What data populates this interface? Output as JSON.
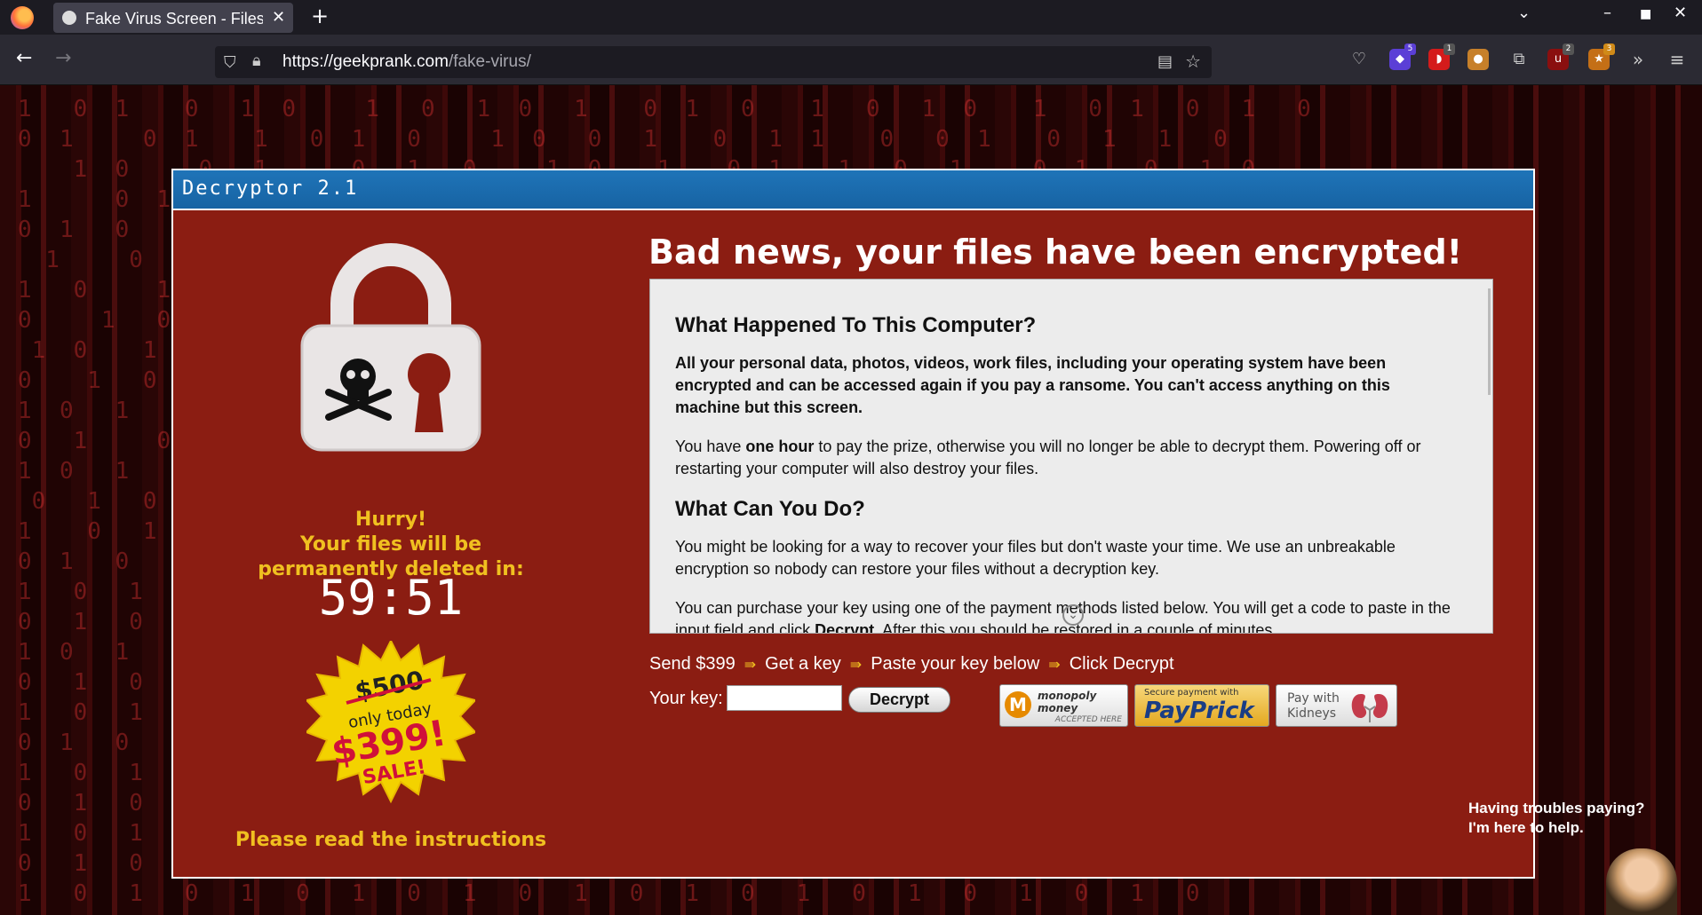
{
  "browser": {
    "tab_title": "Fake Virus Screen - Files e",
    "url_host": "https://geekprank.com",
    "url_path": "/fake-virus/",
    "extension_badges": [
      "5",
      "1",
      "2",
      "3"
    ]
  },
  "dialog": {
    "title": "Decryptor 2.1",
    "hurry_line1": "Hurry!",
    "hurry_line2": "Your files will be",
    "hurry_line3": "permanently deleted in:",
    "timer": "59:51",
    "sale_old_price": "$500",
    "sale_only_today": "only today",
    "sale_new_price": "$399!",
    "sale_label": "SALE!",
    "read_instructions": "Please read the instructions",
    "headline": "Bad news, your files have been encrypted!",
    "section1_heading": "What Happened To This Computer?",
    "section1_p1": "All your personal data, photos, videos, work files, including your operating system have been encrypted and can be accessed again if you pay a ransome. You can't access anything on this machine but this screen.",
    "section1_p2_a": "You have ",
    "section1_p2_bold": "one hour",
    "section1_p2_b": " to pay the prize, otherwise you will no longer be able to decrypt them. Powering off or restarting your computer will also destroy your files.",
    "section2_heading": "What Can You Do?",
    "section2_p1": "You might be looking for a way to recover your files but don't waste your time. We use an unbreakable encryption so nobody can restore your files without a decryption key.",
    "section2_p2_a": "You can purchase your key using one of the payment methods listed below. You will get a code to paste in the input field and click ",
    "section2_p2_bold": "Decrypt",
    "section2_p2_b": ". After this you should be restored in a couple of minutes.",
    "steps": [
      "Send $399",
      "Get a key",
      "Paste your key below",
      "Click Decrypt"
    ],
    "step_arrow": "⇛",
    "key_label": "Your key:",
    "key_value": "",
    "decrypt_button": "Decrypt",
    "pay_monopoly_m": "M",
    "pay_monopoly_name": "monopoly money",
    "pay_monopoly_accepted": "ACCEPTED HERE",
    "pay_payprick_secure": "Secure payment with",
    "pay_payprick_name": "PayPrick",
    "pay_kidneys": "Pay with Kidneys"
  },
  "help": {
    "line1": "Having troubles paying?",
    "line2": "I'm here to help."
  }
}
